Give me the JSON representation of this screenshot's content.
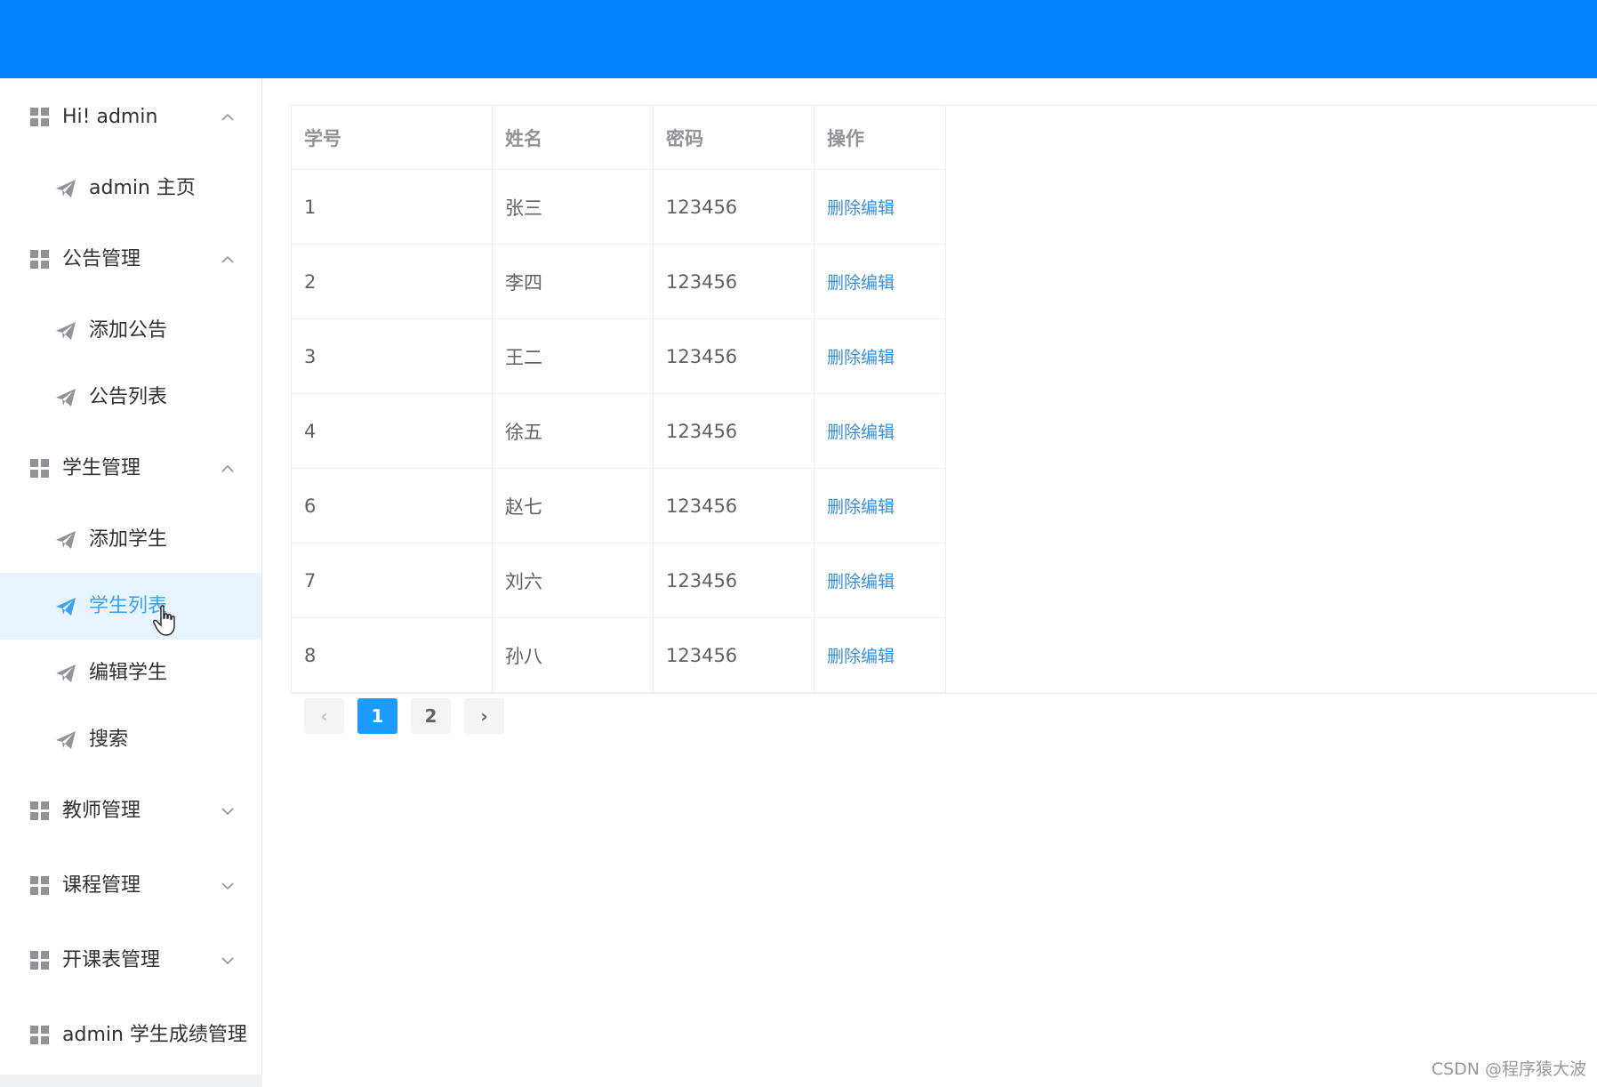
{
  "header": {
    "color": "#0184fd"
  },
  "sidebar": {
    "groups": [
      {
        "label": "Hi! admin",
        "expanded": true,
        "icon": "grid-icon"
      },
      {
        "label": "公告管理",
        "expanded": true,
        "icon": "grid-icon"
      },
      {
        "label": "学生管理",
        "expanded": true,
        "icon": "grid-icon"
      },
      {
        "label": "教师管理",
        "expanded": false,
        "icon": "grid-icon"
      },
      {
        "label": "课程管理",
        "expanded": false,
        "icon": "grid-icon"
      },
      {
        "label": "开课表管理",
        "expanded": false,
        "icon": "grid-icon"
      },
      {
        "label": "admin 学生成绩管理",
        "expanded": false,
        "icon": "grid-icon"
      }
    ],
    "items": [
      {
        "label": "admin 主页",
        "icon": "paper-plane-icon"
      },
      {
        "label": "添加公告",
        "icon": "paper-plane-icon"
      },
      {
        "label": "公告列表",
        "icon": "paper-plane-icon"
      },
      {
        "label": "添加学生",
        "icon": "paper-plane-icon"
      },
      {
        "label": "学生列表",
        "icon": "paper-plane-icon",
        "active": true
      },
      {
        "label": "编辑学生",
        "icon": "paper-plane-icon"
      },
      {
        "label": "搜索",
        "icon": "paper-plane-icon"
      }
    ],
    "active_color": "#3aa3f4"
  },
  "table": {
    "columns": [
      "学号",
      "姓名",
      "密码",
      "操作"
    ],
    "rows": [
      {
        "id": "1",
        "name": "张三",
        "password": "123456",
        "ops": "删除编辑"
      },
      {
        "id": "2",
        "name": "李四",
        "password": "123456",
        "ops": "删除编辑"
      },
      {
        "id": "3",
        "name": "王二",
        "password": "123456",
        "ops": "删除编辑"
      },
      {
        "id": "4",
        "name": "徐五",
        "password": "123456",
        "ops": "删除编辑"
      },
      {
        "id": "6",
        "name": "赵七",
        "password": "123456",
        "ops": "删除编辑"
      },
      {
        "id": "7",
        "name": "刘六",
        "password": "123456",
        "ops": "删除编辑"
      },
      {
        "id": "8",
        "name": "孙八",
        "password": "123456",
        "ops": "删除编辑"
      }
    ]
  },
  "pagination": {
    "prev": "‹",
    "pages": [
      "1",
      "2"
    ],
    "current": "1",
    "next": "›",
    "active_color": "#1e9bff"
  },
  "watermark": "CSDN @程序猿大波"
}
